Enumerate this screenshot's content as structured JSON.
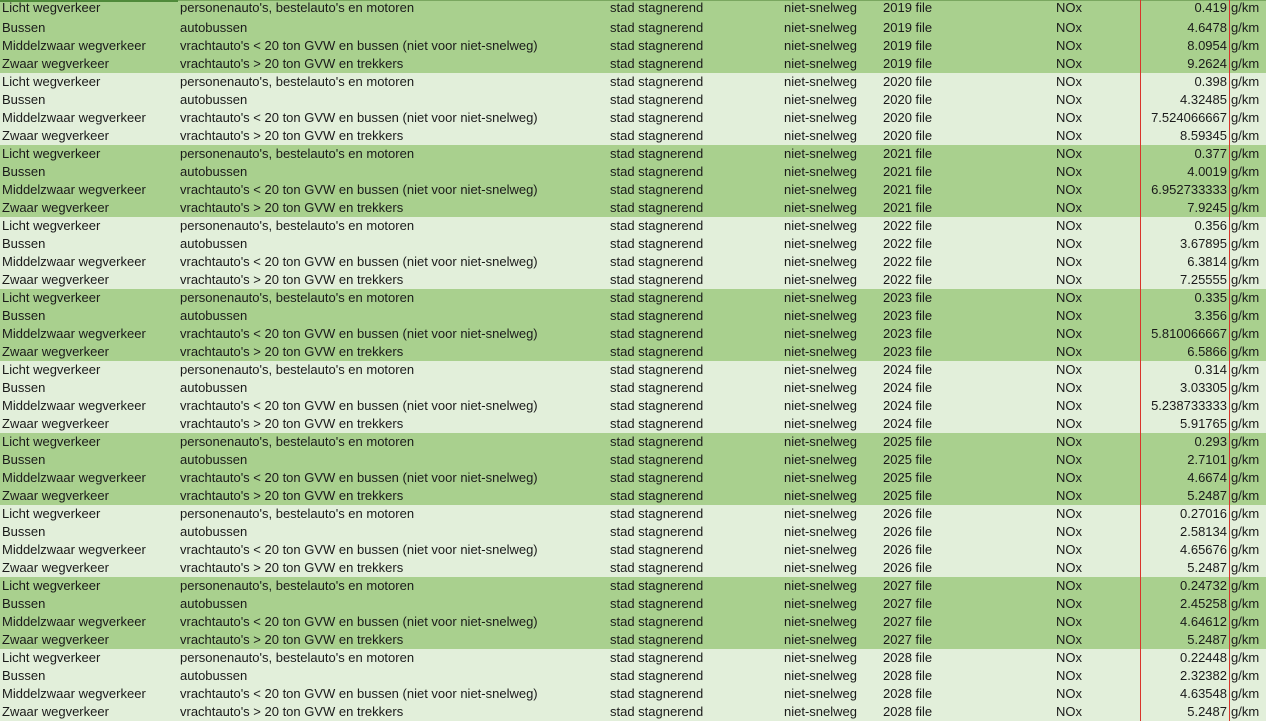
{
  "sheet": {
    "unit": "g/km",
    "rows": [
      {
        "cat": "Licht wegverkeer",
        "desc": "personenauto's, bestelauto's en motoren",
        "road": "stad stagnerend",
        "type": "niet-snelweg",
        "year": "2019 file",
        "pol": "NOx",
        "val": "0.419",
        "unit": "g/km"
      },
      {
        "cat": "Bussen",
        "desc": "autobussen",
        "road": "stad stagnerend",
        "type": "niet-snelweg",
        "year": "2019 file",
        "pol": "NOx",
        "val": "4.6478",
        "unit": "g/km"
      },
      {
        "cat": "Middelzwaar wegverkeer",
        "desc": "vrachtauto's < 20 ton GVW en bussen (niet voor niet-snelweg)",
        "road": "stad stagnerend",
        "type": "niet-snelweg",
        "year": "2019 file",
        "pol": "NOx",
        "val": "8.0954",
        "unit": "g/km"
      },
      {
        "cat": "Zwaar wegverkeer",
        "desc": "vrachtauto's > 20 ton GVW en trekkers",
        "road": "stad stagnerend",
        "type": "niet-snelweg",
        "year": "2019 file",
        "pol": "NOx",
        "val": "9.2624",
        "unit": "g/km"
      },
      {
        "cat": "Licht wegverkeer",
        "desc": "personenauto's, bestelauto's en motoren",
        "road": "stad stagnerend",
        "type": "niet-snelweg",
        "year": "2020 file",
        "pol": "NOx",
        "val": "0.398",
        "unit": "g/km"
      },
      {
        "cat": "Bussen",
        "desc": "autobussen",
        "road": "stad stagnerend",
        "type": "niet-snelweg",
        "year": "2020 file",
        "pol": "NOx",
        "val": "4.32485",
        "unit": "g/km"
      },
      {
        "cat": "Middelzwaar wegverkeer",
        "desc": "vrachtauto's < 20 ton GVW en bussen (niet voor niet-snelweg)",
        "road": "stad stagnerend",
        "type": "niet-snelweg",
        "year": "2020 file",
        "pol": "NOx",
        "val": "7.524066667",
        "unit": "g/km"
      },
      {
        "cat": "Zwaar wegverkeer",
        "desc": "vrachtauto's > 20 ton GVW en trekkers",
        "road": "stad stagnerend",
        "type": "niet-snelweg",
        "year": "2020 file",
        "pol": "NOx",
        "val": "8.59345",
        "unit": "g/km"
      },
      {
        "cat": "Licht wegverkeer",
        "desc": "personenauto's, bestelauto's en motoren",
        "road": "stad stagnerend",
        "type": "niet-snelweg",
        "year": "2021 file",
        "pol": "NOx",
        "val": "0.377",
        "unit": "g/km"
      },
      {
        "cat": "Bussen",
        "desc": "autobussen",
        "road": "stad stagnerend",
        "type": "niet-snelweg",
        "year": "2021 file",
        "pol": "NOx",
        "val": "4.0019",
        "unit": "g/km"
      },
      {
        "cat": "Middelzwaar wegverkeer",
        "desc": "vrachtauto's < 20 ton GVW en bussen (niet voor niet-snelweg)",
        "road": "stad stagnerend",
        "type": "niet-snelweg",
        "year": "2021 file",
        "pol": "NOx",
        "val": "6.952733333",
        "unit": "g/km"
      },
      {
        "cat": "Zwaar wegverkeer",
        "desc": "vrachtauto's > 20 ton GVW en trekkers",
        "road": "stad stagnerend",
        "type": "niet-snelweg",
        "year": "2021 file",
        "pol": "NOx",
        "val": "7.9245",
        "unit": "g/km"
      },
      {
        "cat": "Licht wegverkeer",
        "desc": "personenauto's, bestelauto's en motoren",
        "road": "stad stagnerend",
        "type": "niet-snelweg",
        "year": "2022 file",
        "pol": "NOx",
        "val": "0.356",
        "unit": "g/km"
      },
      {
        "cat": "Bussen",
        "desc": "autobussen",
        "road": "stad stagnerend",
        "type": "niet-snelweg",
        "year": "2022 file",
        "pol": "NOx",
        "val": "3.67895",
        "unit": "g/km"
      },
      {
        "cat": "Middelzwaar wegverkeer",
        "desc": "vrachtauto's < 20 ton GVW en bussen (niet voor niet-snelweg)",
        "road": "stad stagnerend",
        "type": "niet-snelweg",
        "year": "2022 file",
        "pol": "NOx",
        "val": "6.3814",
        "unit": "g/km"
      },
      {
        "cat": "Zwaar wegverkeer",
        "desc": "vrachtauto's > 20 ton GVW en trekkers",
        "road": "stad stagnerend",
        "type": "niet-snelweg",
        "year": "2022 file",
        "pol": "NOx",
        "val": "7.25555",
        "unit": "g/km"
      },
      {
        "cat": "Licht wegverkeer",
        "desc": "personenauto's, bestelauto's en motoren",
        "road": "stad stagnerend",
        "type": "niet-snelweg",
        "year": "2023 file",
        "pol": "NOx",
        "val": "0.335",
        "unit": "g/km"
      },
      {
        "cat": "Bussen",
        "desc": "autobussen",
        "road": "stad stagnerend",
        "type": "niet-snelweg",
        "year": "2023 file",
        "pol": "NOx",
        "val": "3.356",
        "unit": "g/km"
      },
      {
        "cat": "Middelzwaar wegverkeer",
        "desc": "vrachtauto's < 20 ton GVW en bussen (niet voor niet-snelweg)",
        "road": "stad stagnerend",
        "type": "niet-snelweg",
        "year": "2023 file",
        "pol": "NOx",
        "val": "5.810066667",
        "unit": "g/km"
      },
      {
        "cat": "Zwaar wegverkeer",
        "desc": "vrachtauto's > 20 ton GVW en trekkers",
        "road": "stad stagnerend",
        "type": "niet-snelweg",
        "year": "2023 file",
        "pol": "NOx",
        "val": "6.5866",
        "unit": "g/km"
      },
      {
        "cat": "Licht wegverkeer",
        "desc": "personenauto's, bestelauto's en motoren",
        "road": "stad stagnerend",
        "type": "niet-snelweg",
        "year": "2024 file",
        "pol": "NOx",
        "val": "0.314",
        "unit": "g/km"
      },
      {
        "cat": "Bussen",
        "desc": "autobussen",
        "road": "stad stagnerend",
        "type": "niet-snelweg",
        "year": "2024 file",
        "pol": "NOx",
        "val": "3.03305",
        "unit": "g/km"
      },
      {
        "cat": "Middelzwaar wegverkeer",
        "desc": "vrachtauto's < 20 ton GVW en bussen (niet voor niet-snelweg)",
        "road": "stad stagnerend",
        "type": "niet-snelweg",
        "year": "2024 file",
        "pol": "NOx",
        "val": "5.238733333",
        "unit": "g/km"
      },
      {
        "cat": "Zwaar wegverkeer",
        "desc": "vrachtauto's > 20 ton GVW en trekkers",
        "road": "stad stagnerend",
        "type": "niet-snelweg",
        "year": "2024 file",
        "pol": "NOx",
        "val": "5.91765",
        "unit": "g/km"
      },
      {
        "cat": "Licht wegverkeer",
        "desc": "personenauto's, bestelauto's en motoren",
        "road": "stad stagnerend",
        "type": "niet-snelweg",
        "year": "2025 file",
        "pol": "NOx",
        "val": "0.293",
        "unit": "g/km"
      },
      {
        "cat": "Bussen",
        "desc": "autobussen",
        "road": "stad stagnerend",
        "type": "niet-snelweg",
        "year": "2025 file",
        "pol": "NOx",
        "val": "2.7101",
        "unit": "g/km"
      },
      {
        "cat": "Middelzwaar wegverkeer",
        "desc": "vrachtauto's < 20 ton GVW en bussen (niet voor niet-snelweg)",
        "road": "stad stagnerend",
        "type": "niet-snelweg",
        "year": "2025 file",
        "pol": "NOx",
        "val": "4.6674",
        "unit": "g/km"
      },
      {
        "cat": "Zwaar wegverkeer",
        "desc": "vrachtauto's > 20 ton GVW en trekkers",
        "road": "stad stagnerend",
        "type": "niet-snelweg",
        "year": "2025 file",
        "pol": "NOx",
        "val": "5.2487",
        "unit": "g/km"
      },
      {
        "cat": "Licht wegverkeer",
        "desc": "personenauto's, bestelauto's en motoren",
        "road": "stad stagnerend",
        "type": "niet-snelweg",
        "year": "2026 file",
        "pol": "NOx",
        "val": "0.27016",
        "unit": "g/km"
      },
      {
        "cat": "Bussen",
        "desc": "autobussen",
        "road": "stad stagnerend",
        "type": "niet-snelweg",
        "year": "2026 file",
        "pol": "NOx",
        "val": "2.58134",
        "unit": "g/km"
      },
      {
        "cat": "Middelzwaar wegverkeer",
        "desc": "vrachtauto's < 20 ton GVW en bussen (niet voor niet-snelweg)",
        "road": "stad stagnerend",
        "type": "niet-snelweg",
        "year": "2026 file",
        "pol": "NOx",
        "val": "4.65676",
        "unit": "g/km"
      },
      {
        "cat": "Zwaar wegverkeer",
        "desc": "vrachtauto's > 20 ton GVW en trekkers",
        "road": "stad stagnerend",
        "type": "niet-snelweg",
        "year": "2026 file",
        "pol": "NOx",
        "val": "5.2487",
        "unit": "g/km"
      },
      {
        "cat": "Licht wegverkeer",
        "desc": "personenauto's, bestelauto's en motoren",
        "road": "stad stagnerend",
        "type": "niet-snelweg",
        "year": "2027 file",
        "pol": "NOx",
        "val": "0.24732",
        "unit": "g/km"
      },
      {
        "cat": "Bussen",
        "desc": "autobussen",
        "road": "stad stagnerend",
        "type": "niet-snelweg",
        "year": "2027 file",
        "pol": "NOx",
        "val": "2.45258",
        "unit": "g/km"
      },
      {
        "cat": "Middelzwaar wegverkeer",
        "desc": "vrachtauto's < 20 ton GVW en bussen (niet voor niet-snelweg)",
        "road": "stad stagnerend",
        "type": "niet-snelweg",
        "year": "2027 file",
        "pol": "NOx",
        "val": "4.64612",
        "unit": "g/km"
      },
      {
        "cat": "Zwaar wegverkeer",
        "desc": "vrachtauto's > 20 ton GVW en trekkers",
        "road": "stad stagnerend",
        "type": "niet-snelweg",
        "year": "2027 file",
        "pol": "NOx",
        "val": "5.2487",
        "unit": "g/km"
      },
      {
        "cat": "Licht wegverkeer",
        "desc": "personenauto's, bestelauto's en motoren",
        "road": "stad stagnerend",
        "type": "niet-snelweg",
        "year": "2028 file",
        "pol": "NOx",
        "val": "0.22448",
        "unit": "g/km"
      },
      {
        "cat": "Bussen",
        "desc": "autobussen",
        "road": "stad stagnerend",
        "type": "niet-snelweg",
        "year": "2028 file",
        "pol": "NOx",
        "val": "2.32382",
        "unit": "g/km"
      },
      {
        "cat": "Middelzwaar wegverkeer",
        "desc": "vrachtauto's < 20 ton GVW en bussen (niet voor niet-snelweg)",
        "road": "stad stagnerend",
        "type": "niet-snelweg",
        "year": "2028 file",
        "pol": "NOx",
        "val": "4.63548",
        "unit": "g/km"
      },
      {
        "cat": "Zwaar wegverkeer",
        "desc": "vrachtauto's > 20 ton GVW en trekkers",
        "road": "stad stagnerend",
        "type": "niet-snelweg",
        "year": "2028 file",
        "pol": "NOx",
        "val": "5.2487",
        "unit": "g/km"
      }
    ]
  },
  "colors": {
    "band_dark": "#a9d08e",
    "band_light": "#e2efda",
    "column_rule": "#d9342b"
  }
}
